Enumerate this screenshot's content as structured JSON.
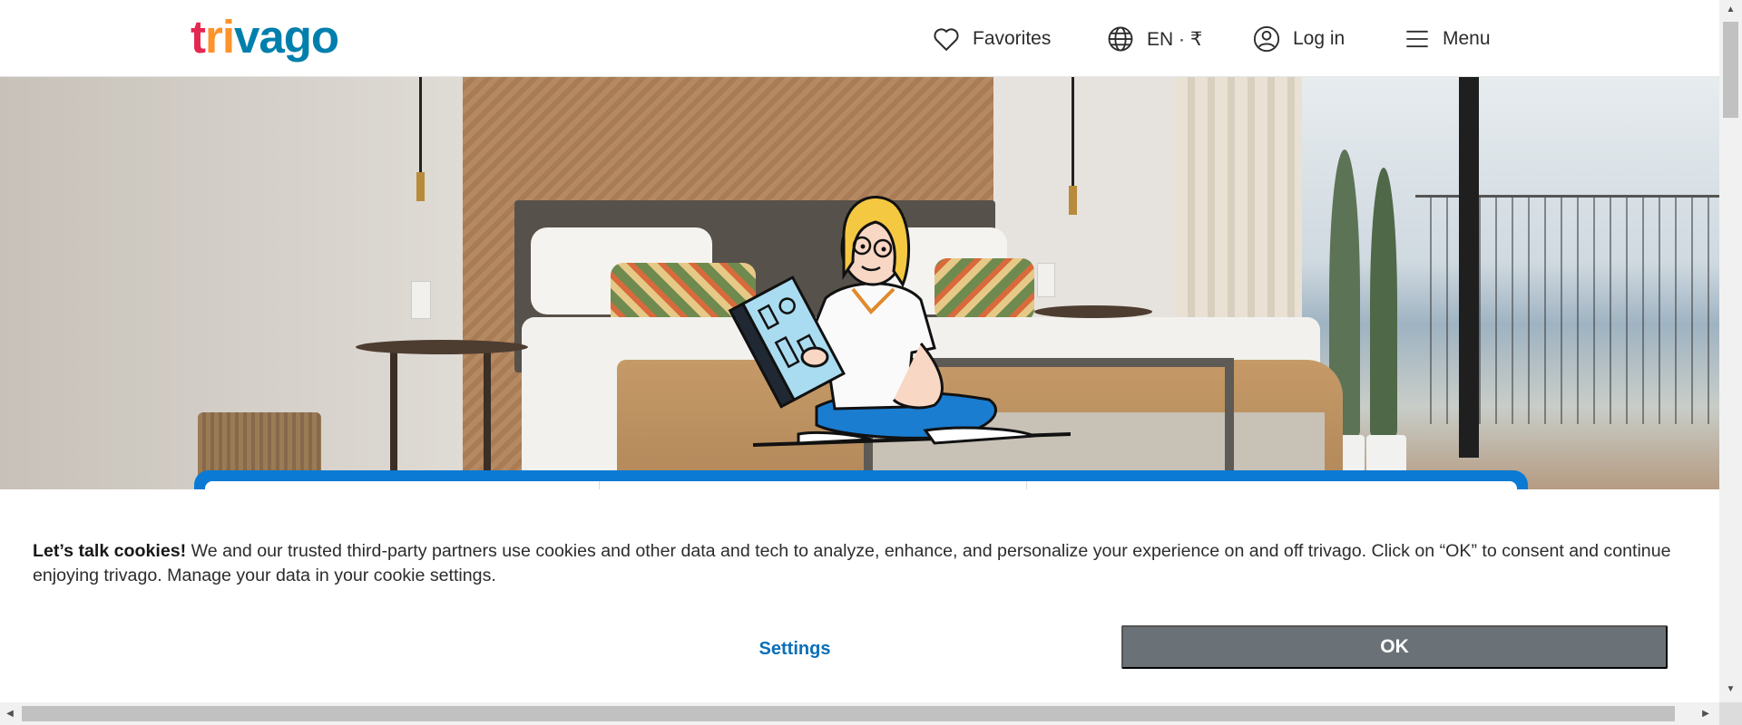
{
  "header": {
    "logo": {
      "part1": "t",
      "part2": "ri",
      "part3": "va",
      "part4": "go"
    },
    "favorites_label": "Favorites",
    "language_label": "EN · ₹",
    "login_label": "Log in",
    "menu_label": "Menu"
  },
  "hero": {
    "illustration_icons": [
      "person-reading-icon"
    ]
  },
  "cookie_banner": {
    "heading": "Let’s talk cookies!",
    "body": " We and our trusted third-party partners use cookies and other data and tech to analyze, enhance, and personalize your experience on and off trivago. Click on “OK” to consent and continue enjoying trivago. Manage your data in your cookie settings.",
    "settings_label": "Settings",
    "ok_label": "OK"
  },
  "scrollbars": {
    "up": "▲",
    "down": "▼",
    "left": "◀",
    "right": "▶"
  },
  "colors": {
    "brand_red": "#e32851",
    "brand_orange": "#ff932c",
    "brand_blue": "#007fad",
    "search_blue": "#0a7ad4",
    "ok_button": "#6b7277",
    "settings_link": "#0a6fb8"
  }
}
